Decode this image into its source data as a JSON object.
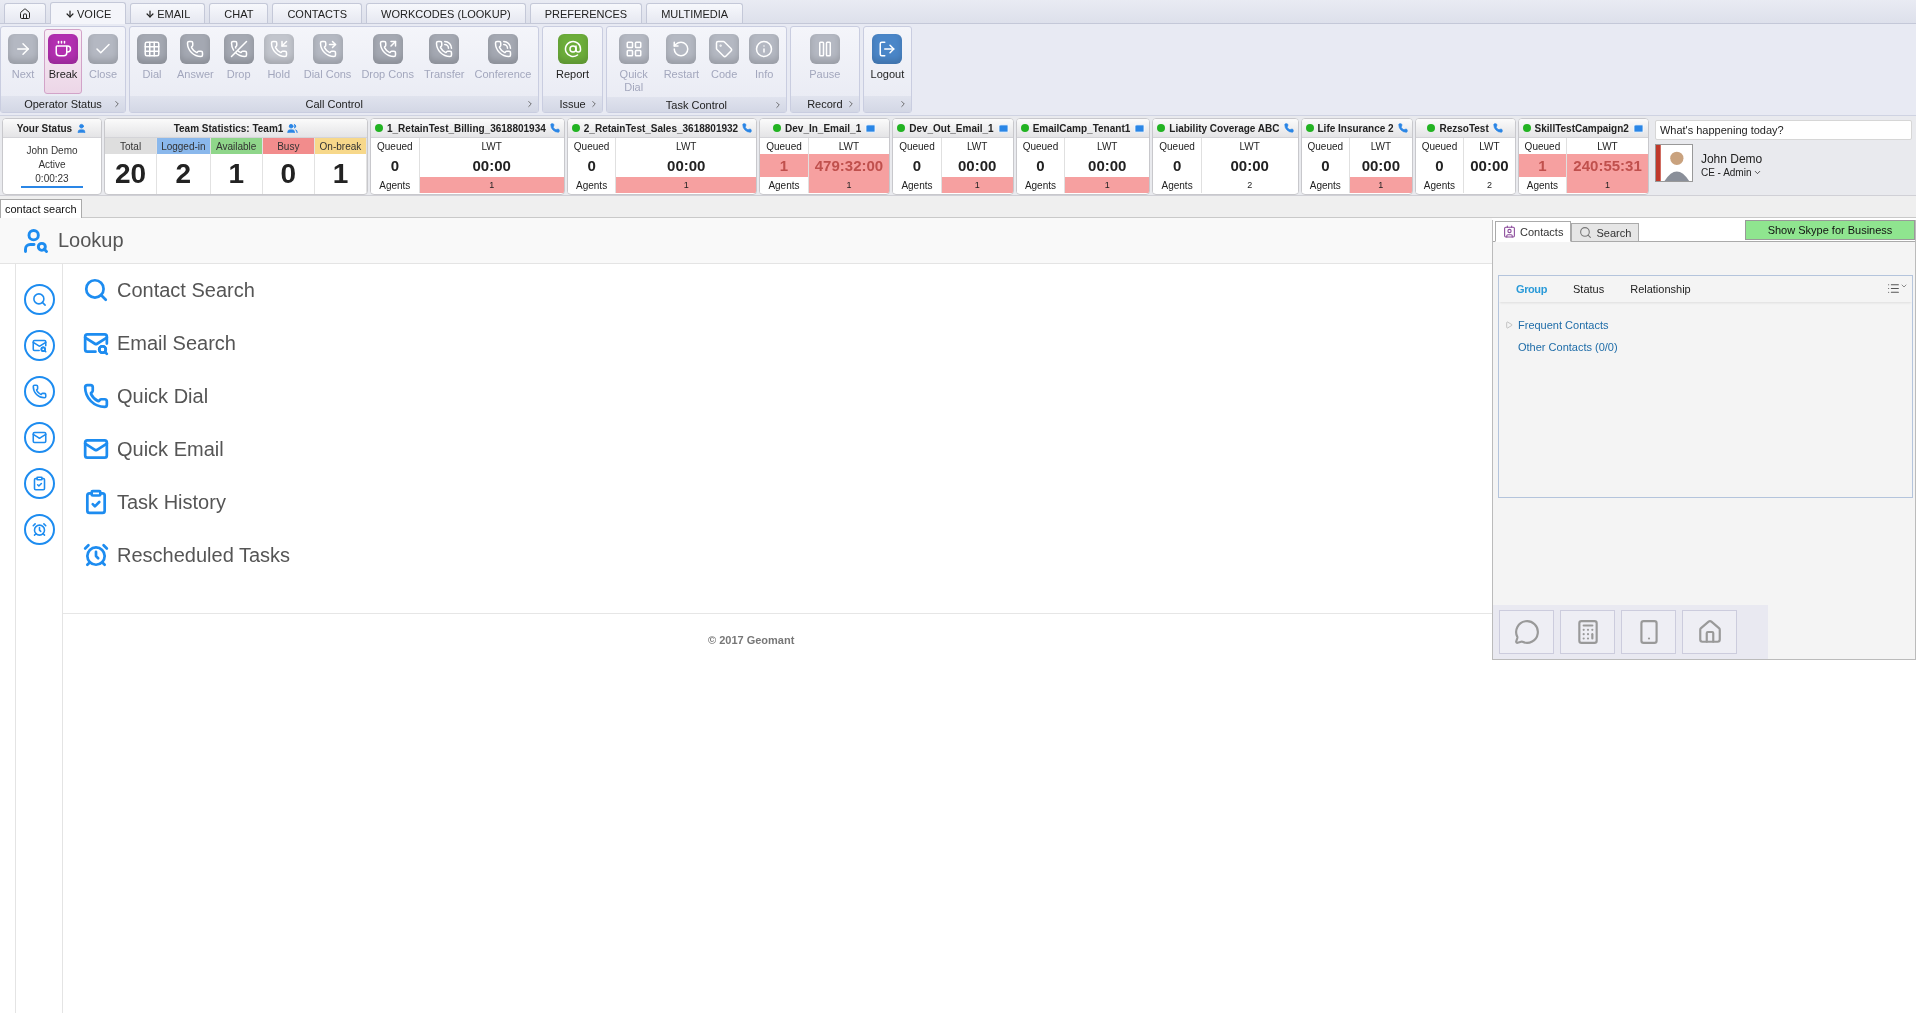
{
  "top_tabs": [
    {
      "kind": "home",
      "selected": false
    },
    {
      "kind": "icon-label",
      "label": "VOICE",
      "selected": true
    },
    {
      "kind": "icon-label",
      "label": "EMAIL",
      "selected": false
    },
    {
      "kind": "label",
      "label": "CHAT",
      "selected": false
    },
    {
      "kind": "label",
      "label": "CONTACTS",
      "selected": false
    },
    {
      "kind": "label",
      "label": "WORKCODES (LOOKUP)",
      "selected": false
    },
    {
      "kind": "label",
      "label": "PREFERENCES",
      "selected": false
    },
    {
      "kind": "label",
      "label": "MULTIMEDIA",
      "selected": false
    }
  ],
  "ribbon": [
    {
      "label": "Operator Status",
      "buttons": [
        {
          "label": "Next",
          "disabled": true,
          "selected": false,
          "color": "#b4b8c2"
        },
        {
          "label": "Break",
          "disabled": false,
          "selected": true,
          "color": "#b22fb0"
        },
        {
          "label": "Close",
          "disabled": true,
          "selected": false,
          "color": "#b4b8c2"
        }
      ]
    },
    {
      "label": "Call Control",
      "buttons": [
        {
          "label": "Dial",
          "disabled": true,
          "selected": false,
          "color": "#a4a8b2"
        },
        {
          "label": "Answer",
          "disabled": true,
          "selected": false,
          "color": "#a4a8b2"
        },
        {
          "label": "Drop",
          "disabled": true,
          "selected": false,
          "color": "#a4a8b2"
        },
        {
          "label": "Hold",
          "disabled": true,
          "selected": false,
          "color": "#c2c5cd"
        },
        {
          "label": "Dial Cons",
          "disabled": true,
          "selected": false,
          "color": "#b4b8c2"
        },
        {
          "label": "Drop Cons",
          "disabled": true,
          "selected": false,
          "color": "#a4a8b2"
        },
        {
          "label": "Transfer",
          "disabled": true,
          "selected": false,
          "color": "#a4a8b2"
        },
        {
          "label": "Conference",
          "disabled": true,
          "selected": false,
          "color": "#a4a8b2"
        }
      ]
    },
    {
      "label": "Issue",
      "buttons": [
        {
          "label": "Report",
          "disabled": false,
          "selected": false,
          "color": "#6cad3a"
        }
      ]
    },
    {
      "label": "Task Control",
      "buttons": [
        {
          "label": "Quick Dial",
          "disabled": true,
          "selected": false,
          "color": "#b4b8c2"
        },
        {
          "label": "Restart",
          "disabled": true,
          "selected": false,
          "color": "#b4b8c2"
        },
        {
          "label": "Code",
          "disabled": true,
          "selected": false,
          "color": "#b4b8c2"
        },
        {
          "label": "Info",
          "disabled": true,
          "selected": false,
          "color": "#b4b8c2"
        }
      ]
    },
    {
      "label": "Record",
      "buttons": [
        {
          "label": "Pause",
          "disabled": true,
          "selected": false,
          "color": "#b4b8c2"
        }
      ]
    },
    {
      "buttons": [
        {
          "label": "Logout",
          "disabled": false,
          "selected": false,
          "color": "#4a86c8"
        }
      ]
    }
  ],
  "your_status": {
    "title": "Your Status",
    "name": "John Demo",
    "state": "Active",
    "timer": "0:00:23"
  },
  "team_stats": {
    "title": "Team Statistics: Team1",
    "cells": [
      {
        "label": "Total",
        "value": "20",
        "color": "#dedede"
      },
      {
        "label": "Logged-in",
        "value": "2",
        "color": "#8ab8ec"
      },
      {
        "label": "Available",
        "value": "1",
        "color": "#8fd68a"
      },
      {
        "label": "Busy",
        "value": "0",
        "color": "#f28c8c"
      },
      {
        "label": "On-break",
        "value": "1",
        "color": "#f7d88a"
      }
    ]
  },
  "queues": [
    {
      "name": "1_RetainTest_Billing_3618801934",
      "kind": "phone",
      "color": "#22b322",
      "queued_label": "Queued",
      "lwt_label": "LWT",
      "agents_label": "Agents",
      "queued": "0",
      "lwt": "00:00",
      "agents": "1",
      "queued_alert": false,
      "lwt_alert": false,
      "agents_alert": true
    },
    {
      "name": "2_RetainTest_Sales_3618801932",
      "kind": "phone",
      "color": "#22b322",
      "queued_label": "Queued",
      "lwt_label": "LWT",
      "agents_label": "Agents",
      "queued": "0",
      "lwt": "00:00",
      "agents": "1",
      "queued_alert": false,
      "lwt_alert": false,
      "agents_alert": true
    },
    {
      "name": "Dev_In_Email_1",
      "kind": "email",
      "color": "#22b322",
      "queued_label": "Queued",
      "lwt_label": "LWT",
      "agents_label": "Agents",
      "queued": "1",
      "lwt": "479:32:00",
      "agents": "1",
      "queued_alert": true,
      "lwt_alert": true,
      "agents_alert": true
    },
    {
      "name": "Dev_Out_Email_1",
      "kind": "email",
      "color": "#22b322",
      "queued_label": "Queued",
      "lwt_label": "LWT",
      "agents_label": "Agents",
      "queued": "0",
      "lwt": "00:00",
      "agents": "1",
      "queued_alert": false,
      "lwt_alert": false,
      "agents_alert": true
    },
    {
      "name": "EmailCamp_Tenant1",
      "kind": "email",
      "color": "#22b322",
      "queued_label": "Queued",
      "lwt_label": "LWT",
      "agents_label": "Agents",
      "queued": "0",
      "lwt": "00:00",
      "agents": "1",
      "queued_alert": false,
      "lwt_alert": false,
      "agents_alert": true
    },
    {
      "name": "Liability Coverage ABC",
      "kind": "phone",
      "color": "#22b322",
      "queued_label": "Queued",
      "lwt_label": "LWT",
      "agents_label": "Agents",
      "queued": "0",
      "lwt": "00:00",
      "agents": "2",
      "queued_alert": false,
      "lwt_alert": false,
      "agents_alert": false
    },
    {
      "name": "Life Insurance 2",
      "kind": "phone",
      "color": "#22b322",
      "queued_label": "Queued",
      "lwt_label": "LWT",
      "agents_label": "Agents",
      "queued": "0",
      "lwt": "00:00",
      "agents": "1",
      "queued_alert": false,
      "lwt_alert": false,
      "agents_alert": true
    },
    {
      "name": "RezsoTest",
      "kind": "phone",
      "color": "#22b322",
      "queued_label": "Queued",
      "lwt_label": "LWT",
      "agents_label": "Agents",
      "queued": "0",
      "lwt": "00:00",
      "agents": "2",
      "queued_alert": false,
      "lwt_alert": false,
      "agents_alert": false
    },
    {
      "name": "SkillTestCampaign2",
      "kind": "email",
      "color": "#22b322",
      "queued_label": "Queued",
      "lwt_label": "LWT",
      "agents_label": "Agents",
      "queued": "1",
      "lwt": "240:55:31",
      "agents": "1",
      "queued_alert": true,
      "lwt_alert": true,
      "agents_alert": true
    }
  ],
  "social": {
    "placeholder": "What's happening today?",
    "name": "John Demo",
    "role": "CE - Admin"
  },
  "page_tab": {
    "label": "contact search",
    "selected": true
  },
  "lookup": {
    "title": "Lookup",
    "items": [
      {
        "label": "Contact Search"
      },
      {
        "label": "Email Search"
      },
      {
        "label": "Quick Dial"
      },
      {
        "label": "Quick Email"
      },
      {
        "label": "Task History"
      },
      {
        "label": "Rescheduled Tasks"
      }
    ]
  },
  "footer": "© 2017 Geomant",
  "contacts_panel": {
    "tabs": [
      {
        "label": "Contacts",
        "selected": true
      },
      {
        "label": "Search",
        "selected": false
      }
    ],
    "skype_button": "Show Skype for Business",
    "filters": [
      {
        "label": "Group",
        "selected": true
      },
      {
        "label": "Status",
        "selected": false
      },
      {
        "label": "Relationship",
        "selected": false
      }
    ],
    "groups": [
      {
        "label": "Frequent Contacts",
        "expandable": true
      },
      {
        "label": "Other Contacts (0/0)",
        "expandable": false
      }
    ]
  }
}
